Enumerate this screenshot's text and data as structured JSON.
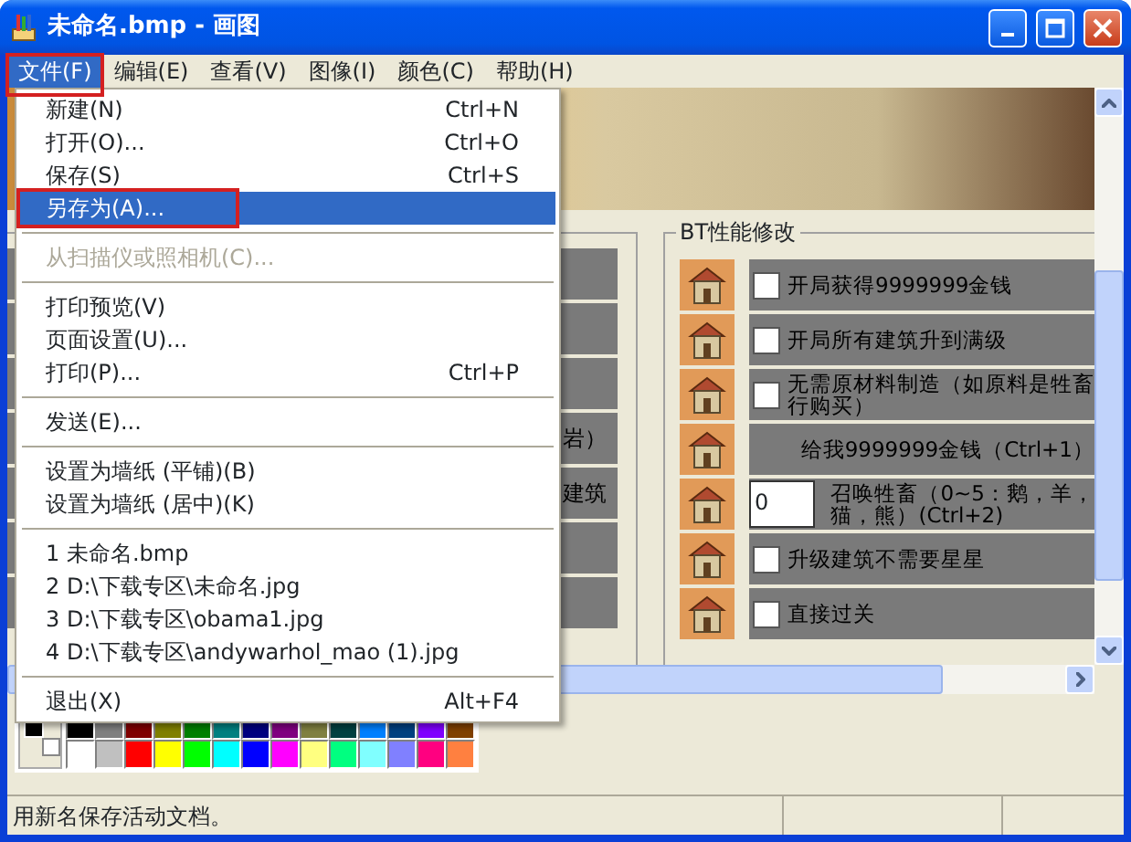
{
  "window": {
    "title": "未命名.bmp - 画图"
  },
  "menubar": [
    {
      "label": "文件(F)",
      "selected": true
    },
    {
      "label": "编辑(E)",
      "selected": false
    },
    {
      "label": "查看(V)",
      "selected": false
    },
    {
      "label": "图像(I)",
      "selected": false
    },
    {
      "label": "颜色(C)",
      "selected": false
    },
    {
      "label": "帮助(H)",
      "selected": false
    }
  ],
  "file_menu": [
    {
      "kind": "item",
      "label": "新建(N)",
      "shortcut": "Ctrl+N",
      "selected": false,
      "disabled": false
    },
    {
      "kind": "item",
      "label": "打开(O)...",
      "shortcut": "Ctrl+O",
      "selected": false,
      "disabled": false
    },
    {
      "kind": "item",
      "label": "保存(S)",
      "shortcut": "Ctrl+S",
      "selected": false,
      "disabled": false
    },
    {
      "kind": "item",
      "label": "另存为(A)...",
      "selected": true,
      "disabled": false
    },
    {
      "kind": "separator"
    },
    {
      "kind": "item",
      "label": "从扫描仪或照相机(C)...",
      "selected": false,
      "disabled": true
    },
    {
      "kind": "separator"
    },
    {
      "kind": "item",
      "label": "打印预览(V)",
      "selected": false,
      "disabled": false
    },
    {
      "kind": "item",
      "label": "页面设置(U)...",
      "selected": false,
      "disabled": false
    },
    {
      "kind": "item",
      "label": "打印(P)...",
      "shortcut": "Ctrl+P",
      "selected": false,
      "disabled": false
    },
    {
      "kind": "separator"
    },
    {
      "kind": "item",
      "label": "发送(E)...",
      "selected": false,
      "disabled": false
    },
    {
      "kind": "separator"
    },
    {
      "kind": "item",
      "label": "设置为墙纸 (平铺)(B)",
      "selected": false,
      "disabled": false
    },
    {
      "kind": "item",
      "label": "设置为墙纸 (居中)(K)",
      "selected": false,
      "disabled": false
    },
    {
      "kind": "separator"
    },
    {
      "kind": "item",
      "label": "1 未命名.bmp",
      "selected": false,
      "disabled": false
    },
    {
      "kind": "item",
      "label": "2 D:\\下载专区\\未命名.jpg",
      "selected": false,
      "disabled": false
    },
    {
      "kind": "item",
      "label": "3 D:\\下载专区\\obama1.jpg",
      "selected": false,
      "disabled": false
    },
    {
      "kind": "item",
      "label": "4 D:\\下载专区\\andywarhol_mao (1).jpg",
      "selected": false,
      "disabled": false
    },
    {
      "kind": "separator"
    },
    {
      "kind": "item",
      "label": "退出(X)",
      "shortcut": "Alt+F4",
      "selected": false,
      "disabled": false
    }
  ],
  "canvas_image": {
    "left_panel": {
      "rows": [
        {},
        {},
        {},
        {
          "text": "岩）"
        },
        {
          "text": "建筑"
        },
        {},
        {}
      ]
    },
    "group": {
      "title": "BT性能修改",
      "rows": [
        {
          "kind": "checkbox",
          "checked": false,
          "lines": [
            "开局获得9999999金钱"
          ]
        },
        {
          "kind": "checkbox",
          "checked": false,
          "lines": [
            "开局所有建筑升到满级"
          ]
        },
        {
          "kind": "checkbox",
          "checked": false,
          "lines": [
            "无需原材料制造（如原料是牲畜",
            "行购买）"
          ]
        },
        {
          "kind": "button",
          "lines": [
            "给我9999999金钱（Ctrl+1）"
          ]
        },
        {
          "kind": "input",
          "value": "0",
          "lines": [
            "召唤牲畜（0~5：鹅，羊，",
            "猫，熊）(Ctrl+2)"
          ]
        },
        {
          "kind": "checkbox",
          "checked": false,
          "lines": [
            "升级建筑不需要星星"
          ]
        },
        {
          "kind": "checkbox",
          "checked": false,
          "lines": [
            "直接过关"
          ]
        }
      ]
    }
  },
  "palette": {
    "current": [
      {
        "color": "#000000"
      },
      {
        "color": "#ffffff"
      }
    ],
    "colors": [
      {
        "color": "#000000"
      },
      {
        "color": "#808080"
      },
      {
        "color": "#800000"
      },
      {
        "color": "#808000"
      },
      {
        "color": "#008000"
      },
      {
        "color": "#008080"
      },
      {
        "color": "#000080"
      },
      {
        "color": "#800080"
      },
      {
        "color": "#808040"
      },
      {
        "color": "#004040"
      },
      {
        "color": "#0080ff"
      },
      {
        "color": "#004080"
      },
      {
        "color": "#8000ff"
      },
      {
        "color": "#804000"
      },
      {
        "color": "#ffffff"
      },
      {
        "color": "#c0c0c0"
      },
      {
        "color": "#ff0000"
      },
      {
        "color": "#ffff00"
      },
      {
        "color": "#00ff00"
      },
      {
        "color": "#00ffff"
      },
      {
        "color": "#0000ff"
      },
      {
        "color": "#ff00ff"
      },
      {
        "color": "#ffff80"
      },
      {
        "color": "#00ff80"
      },
      {
        "color": "#80ffff"
      },
      {
        "color": "#8080ff"
      },
      {
        "color": "#ff0080"
      },
      {
        "color": "#ff8040"
      }
    ]
  },
  "status_bar": {
    "text": "用新名保存活动文档。"
  }
}
